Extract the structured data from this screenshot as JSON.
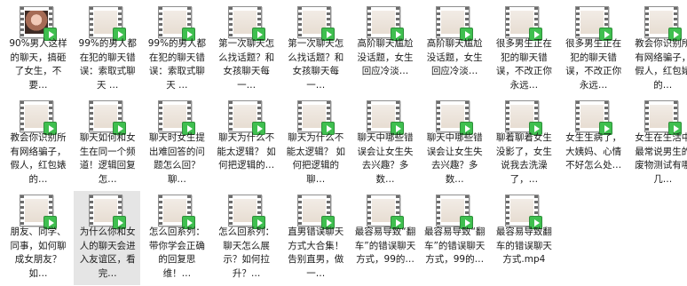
{
  "files": [
    {
      "label": "90%男人这样的聊天，搞砸了女生，不要…",
      "thumb": "photo"
    },
    {
      "label": "99%的男人都在犯的聊天错误：索取式聊天 …",
      "thumb": "film"
    },
    {
      "label": "99%的男人都在犯的聊天错误：索取式聊天 …",
      "thumb": "film"
    },
    {
      "label": "第一次聊天怎么找话题？和女孩聊天每一…",
      "thumb": "film"
    },
    {
      "label": "第一次聊天怎么找话题？和女孩聊天每一…",
      "thumb": "film"
    },
    {
      "label": "高阶聊天尴尬没话题，女生回应冷淡…",
      "thumb": "film"
    },
    {
      "label": "高阶聊天尴尬没话题，女生回应冷淡…",
      "thumb": "film"
    },
    {
      "label": "很多男生正在犯的聊天错误，不改正你永远…",
      "thumb": "film"
    },
    {
      "label": "很多男生正在犯的聊天错误，不改正你永远…",
      "thumb": "film"
    },
    {
      "label": "教会你识别所有网络骗子，假人，红包婊的…",
      "thumb": "film"
    },
    {
      "label": "教会你识别所有网络骗子，假人，红包婊的…",
      "thumb": "film"
    },
    {
      "label": "聊天如何和女生在同一个频道！逻辑回复怎…",
      "thumb": "film"
    },
    {
      "label": "聊天时女生提出难回答的问题怎么回？ 聊…",
      "thumb": "film"
    },
    {
      "label": "聊天为什么不能太逻辑？ 如何把逻辑的…",
      "thumb": "film"
    },
    {
      "label": "聊天为什么不能太逻辑？ 如何把逻辑的聊…",
      "thumb": "film"
    },
    {
      "label": "聊天中哪些错误会让女生失去兴趣？多数…",
      "thumb": "film"
    },
    {
      "label": "聊天中哪些错误会让女生失去兴趣？多数…",
      "thumb": "film"
    },
    {
      "label": "聊着聊着女生没影了，女生说我去洗澡了，…",
      "thumb": "film"
    },
    {
      "label": "女生生病了，大姨妈、心情不好怎么处…",
      "thumb": "film"
    },
    {
      "label": "女生在生活中最常说男生的废物测试有哪几…",
      "thumb": "film"
    },
    {
      "label": "朋友、同学、同事，如何聊成女朋友？如…",
      "thumb": "film"
    },
    {
      "label": "为什么你和女人的聊天会进入友谊区，看完…",
      "thumb": "film"
    },
    {
      "label": "怎么回系列：带你学会正确的回复思维！…",
      "thumb": "film"
    },
    {
      "label": "怎么回系列：聊天怎么展示？如何拉升？…",
      "thumb": "film"
    },
    {
      "label": "直男错误聊天方式大合集！告别直男，做一…",
      "thumb": "film"
    },
    {
      "label": "最容易导致“翻车”的错误聊天方式，99的…",
      "thumb": "film"
    },
    {
      "label": "最容易导致“翻车”的错误聊天方式，99的…",
      "thumb": "film"
    },
    {
      "label": "最容易导致翻车的错误聊天方式.mp4",
      "thumb": "film"
    }
  ],
  "selected_index": 21
}
